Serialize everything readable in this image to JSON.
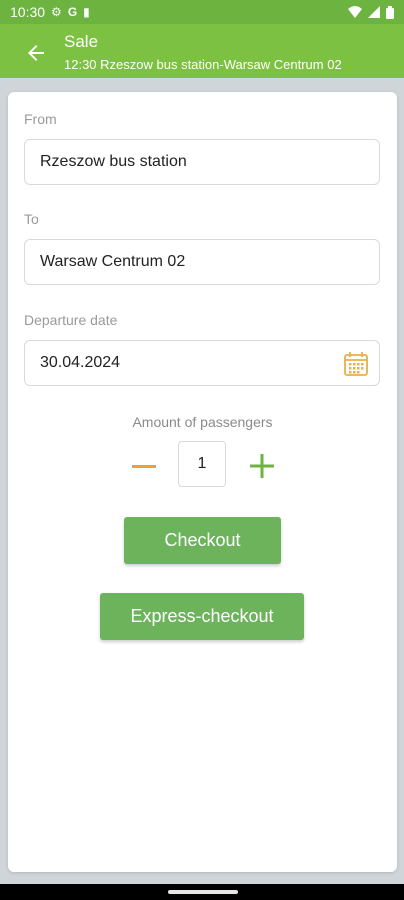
{
  "status_bar": {
    "time": "10:30",
    "icons_left": [
      "gear-icon",
      "google-icon",
      "sim-card-icon"
    ],
    "icons_right": [
      "wifi-icon",
      "signal-icon",
      "battery-icon"
    ]
  },
  "app_bar": {
    "title": "Sale",
    "subtitle": "12:30 Rzeszow bus station-Warsaw Centrum 02"
  },
  "form": {
    "from_label": "From",
    "from_value": "Rzeszow bus station",
    "to_label": "To",
    "to_value": "Warsaw Centrum 02",
    "date_label": "Departure date",
    "date_value": "30.04.2024",
    "passengers_label": "Amount of passengers",
    "passengers_value": "1"
  },
  "buttons": {
    "checkout": "Checkout",
    "express_checkout": "Express-checkout"
  },
  "colors": {
    "status_bar": "#6db33f",
    "app_bar": "#7dc142",
    "button": "#6cb35c",
    "minus": "#e8a23a",
    "plus": "#6cb33f",
    "calendar": "#e8b04a"
  }
}
